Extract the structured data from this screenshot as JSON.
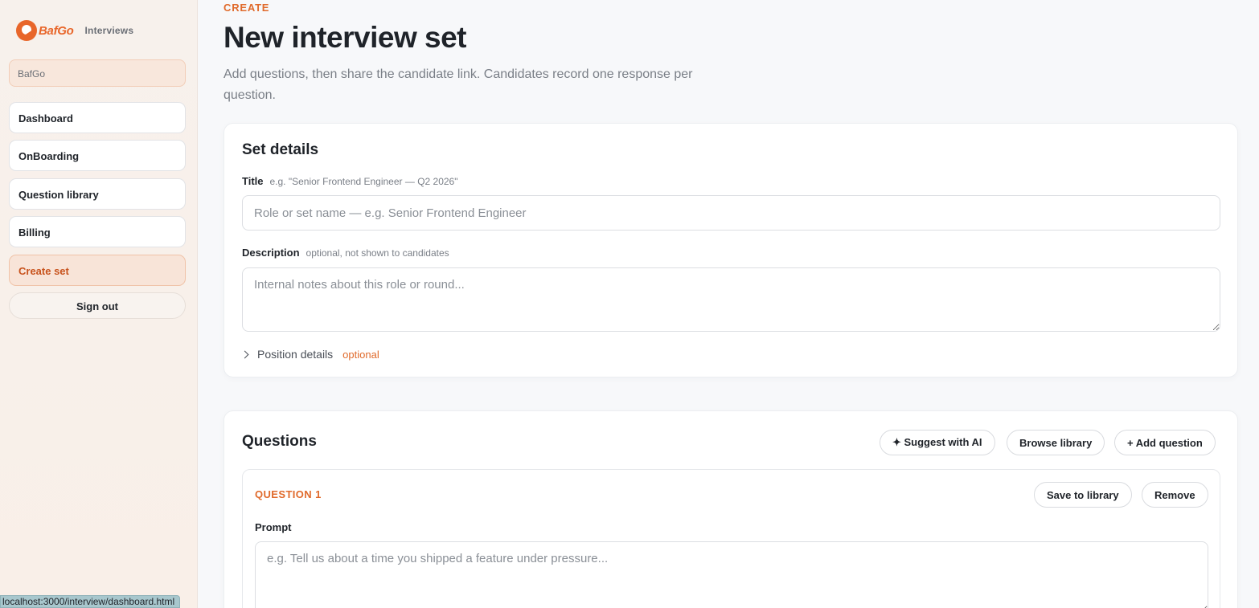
{
  "sidebar": {
    "logo_text_a": "Baf",
    "logo_text_b": "Go",
    "app_name": "Interviews",
    "org_name": "BafGo",
    "nav": [
      {
        "label": "Dashboard"
      },
      {
        "label": "OnBoarding"
      },
      {
        "label": "Question library"
      },
      {
        "label": "Billing"
      },
      {
        "label": "Create set"
      }
    ],
    "signout_label": "Sign out"
  },
  "status_bar": {
    "url": "localhost:3000/interview/dashboard.html"
  },
  "header": {
    "eyebrow": "CREATE",
    "title": "New interview set",
    "subtitle": "Add questions, then share the candidate link. Candidates record one response per question."
  },
  "set_details": {
    "title": "Set details",
    "title_label": "Title",
    "title_hint": "e.g. \"Senior Frontend Engineer — Q2 2026\"",
    "title_placeholder": "Role or set name — e.g. Senior Frontend Engineer",
    "description_label": "Description",
    "description_hint": "optional, not shown to candidates",
    "description_placeholder": "Internal notes about this role or round...",
    "position_label": "Position details",
    "position_tag": "optional"
  },
  "questions": {
    "title": "Questions",
    "suggest_label": "✦ Suggest with AI",
    "browse_label": "Browse library",
    "add_label": "+ Add question",
    "items": [
      {
        "label": "QUESTION 1",
        "save_label": "Save to library",
        "remove_label": "Remove",
        "prompt_label": "Prompt",
        "prompt_placeholder": "e.g. Tell us about a time you shipped a feature under pressure..."
      }
    ]
  },
  "colors": {
    "accent": "#e06a2b",
    "sidebar_bg": "#f7f1ec",
    "active_nav_bg": "#f8e4d8"
  }
}
